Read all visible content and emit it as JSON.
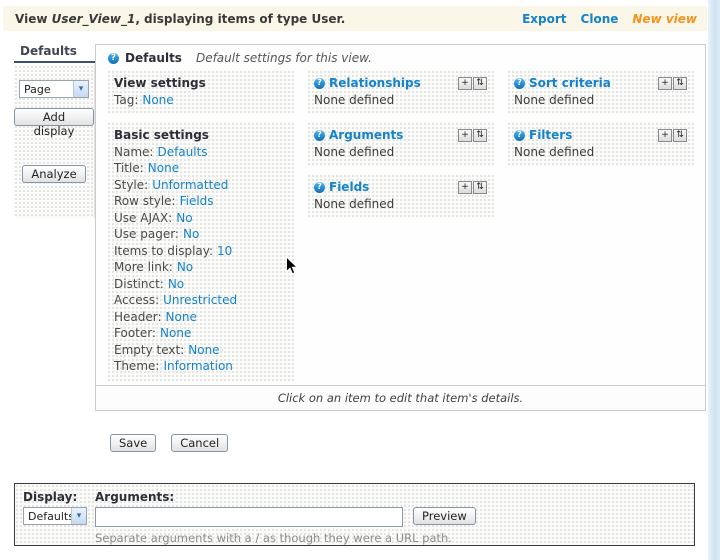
{
  "header": {
    "text_prefix": "View ",
    "view_name": "User_View_1",
    "text_suffix": ", displaying items of type User.",
    "links": {
      "export": "Export",
      "clone": "Clone",
      "new_view": "New view"
    }
  },
  "sidebar": {
    "tab_label": "Defaults",
    "display_type_value": "Page",
    "add_display_label": "Add display",
    "analyze_label": "Analyze"
  },
  "main": {
    "heading_title": "Defaults",
    "heading_description": "Default settings for this view.",
    "view_settings": {
      "title": "View settings",
      "rows": [
        {
          "label": "Tag:",
          "value": "None"
        }
      ]
    },
    "basic_settings": {
      "title": "Basic settings",
      "rows": [
        {
          "label": "Name:",
          "value": "Defaults"
        },
        {
          "label": "Title:",
          "value": "None"
        },
        {
          "label": "Style:",
          "value": "Unformatted"
        },
        {
          "label": "Row style:",
          "value": "Fields"
        },
        {
          "label": "Use AJAX:",
          "value": "No"
        },
        {
          "label": "Use pager:",
          "value": "No"
        },
        {
          "label": "Items to display:",
          "value": "10"
        },
        {
          "label": "More link:",
          "value": "No"
        },
        {
          "label": "Distinct:",
          "value": "No"
        },
        {
          "label": "Access:",
          "value": "Unrestricted"
        },
        {
          "label": "Header:",
          "value": "None"
        },
        {
          "label": "Footer:",
          "value": "None"
        },
        {
          "label": "Empty text:",
          "value": "None"
        },
        {
          "label": "Theme:",
          "value": "Information"
        }
      ]
    },
    "categories": {
      "relationships": {
        "title": "Relationships",
        "empty": "None defined"
      },
      "arguments": {
        "title": "Arguments",
        "empty": "None defined"
      },
      "fields": {
        "title": "Fields",
        "empty": "None defined"
      },
      "sort_criteria": {
        "title": "Sort criteria",
        "empty": "None defined"
      },
      "filters": {
        "title": "Filters",
        "empty": "None defined"
      }
    },
    "footer_note": "Click on an item to edit that item's details."
  },
  "actions": {
    "save": "Save",
    "cancel": "Cancel"
  },
  "preview": {
    "display_label": "Display:",
    "display_value": "Defaults",
    "arguments_label": "Arguments:",
    "arguments_value": "",
    "preview_button": "Preview",
    "help_text": "Separate arguments with a / as though they were a URL path."
  },
  "icons": {
    "help": "?",
    "add": "+",
    "rearrange": "⇅",
    "dropdown": "▾"
  },
  "colors": {
    "link_blue": "#1583c9",
    "accent_orange": "#f6921e",
    "header_bg": "#fbf7e8",
    "tab_underline": "#39536f"
  }
}
